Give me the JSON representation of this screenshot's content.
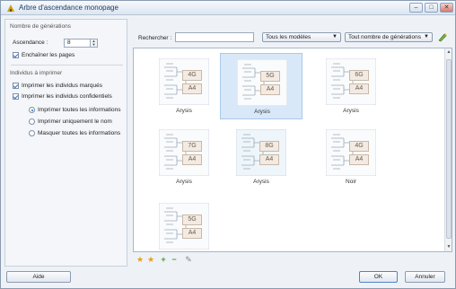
{
  "window": {
    "title": "Arbre d'ascendance monopage"
  },
  "left_panel": {
    "generations_group": "Nombre de générations",
    "ascendance_label": "Ascendance :",
    "ascendance_value": "8",
    "chain_pages": "Enchaîner les pages",
    "individus_group": "Individus à imprimer",
    "print_marked": "Imprimer les individus marqués",
    "print_confidential": "Imprimer les individus confidentiels",
    "radio_all": "Imprimer toutes les informations",
    "radio_name": "Imprimer uniquement le nom",
    "radio_hide": "Masquer toutes les informations"
  },
  "toolbar": {
    "search_label": "Rechercher :",
    "search_value": "",
    "models_select": "Tous les modèles",
    "generations_select": "Tout nombre de générations"
  },
  "models": [
    {
      "gen": "4G",
      "format": "A4",
      "label": "Arysis",
      "selected": false
    },
    {
      "gen": "5G",
      "format": "A4",
      "label": "Arysis",
      "selected": true
    },
    {
      "gen": "6G",
      "format": "A4",
      "label": "Arysis",
      "selected": false
    },
    {
      "gen": "7G",
      "format": "A4",
      "label": "Arysis",
      "selected": false
    },
    {
      "gen": "8G",
      "format": "A4",
      "label": "Arysis",
      "selected": false
    },
    {
      "gen": "4G",
      "format": "A4",
      "label": "Noir",
      "selected": false
    },
    {
      "gen": "5G",
      "format": "A4",
      "label": "",
      "selected": false
    }
  ],
  "footer": {
    "help": "Aide",
    "ok": "OK",
    "cancel": "Annuler"
  },
  "colors": {
    "accent": "#2a6fbf",
    "selection": "#d8e8f8"
  }
}
